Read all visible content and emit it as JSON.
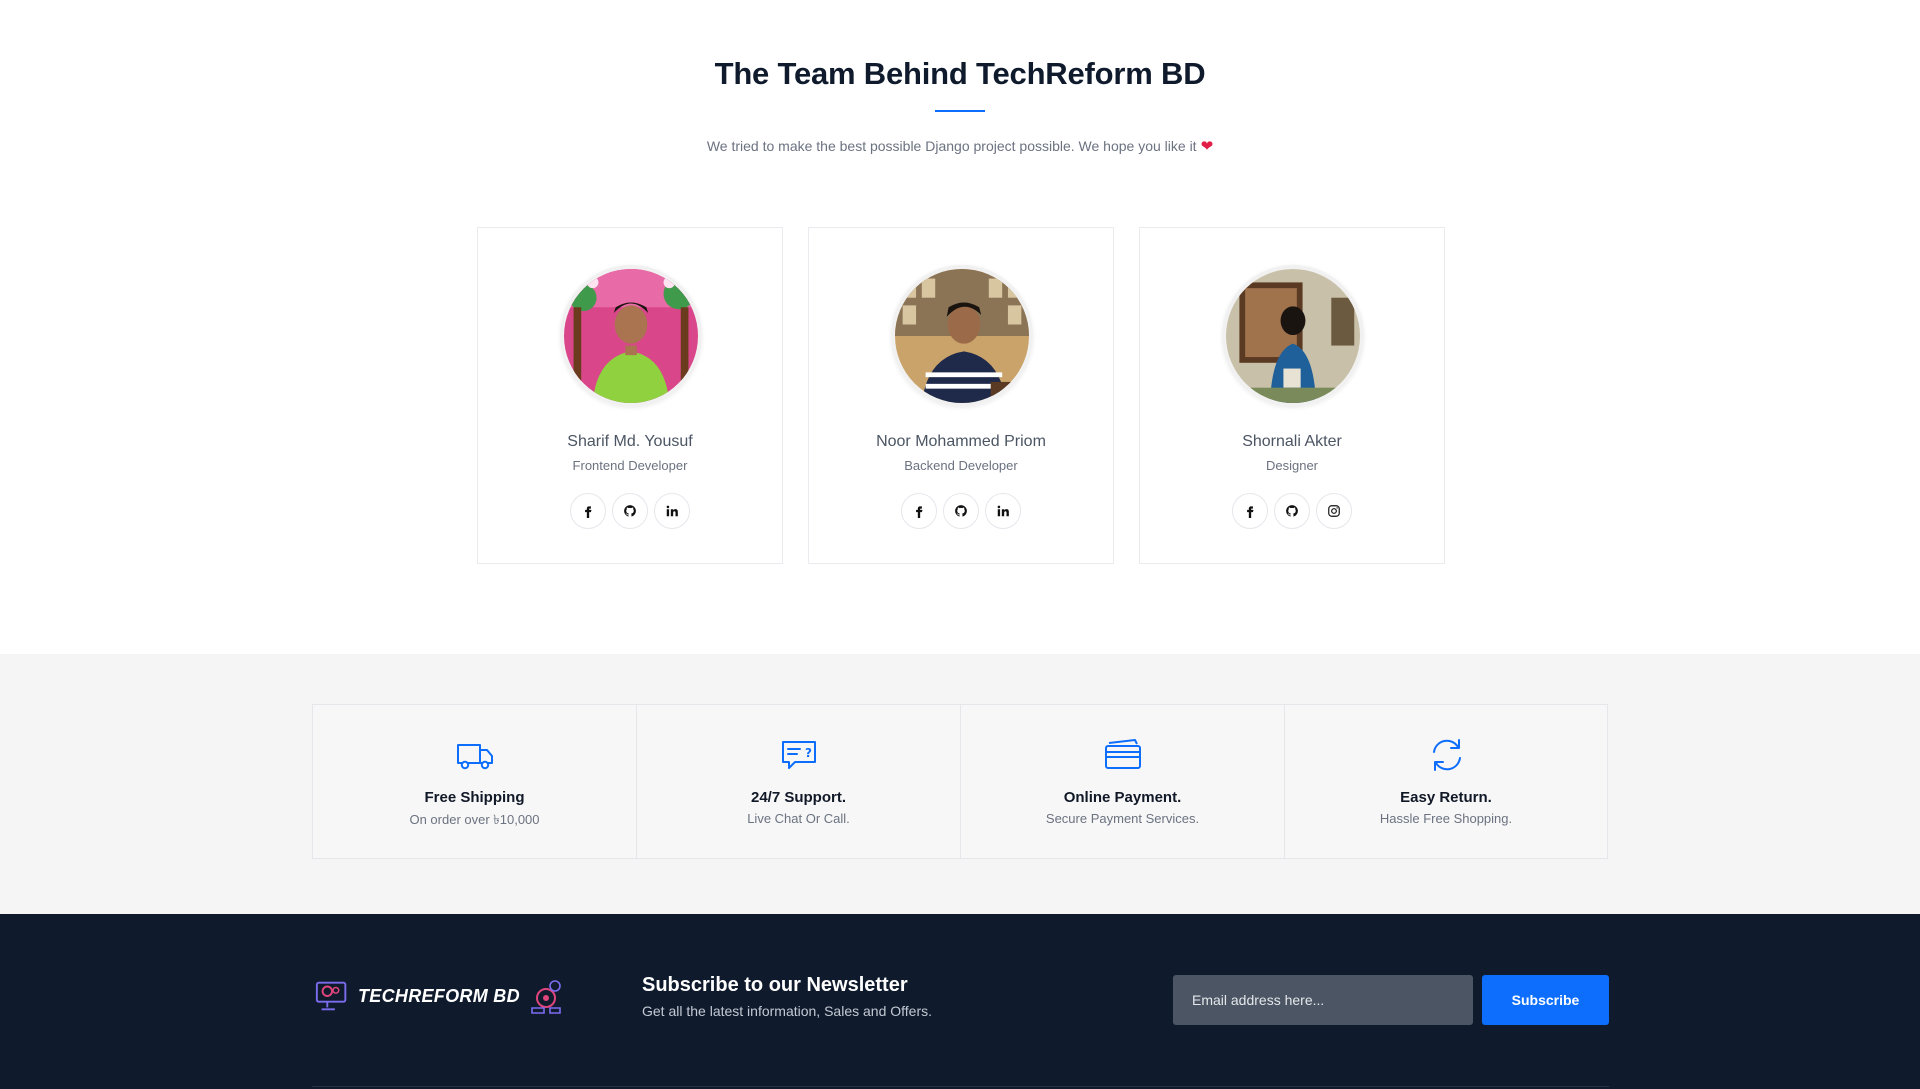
{
  "team": {
    "title": "The Team Behind TechReform BD",
    "subtitle": "We tried to make the best possible Django project possible. We hope you like it",
    "heart_icon": "heart-icon",
    "members": [
      {
        "name": "Sharif Md. Yousuf",
        "role": "Frontend Developer",
        "socials": [
          "facebook-icon",
          "github-icon",
          "linkedin-icon"
        ]
      },
      {
        "name": "Noor Mohammed Priom",
        "role": "Backend Developer",
        "socials": [
          "facebook-icon",
          "github-icon",
          "linkedin-icon"
        ]
      },
      {
        "name": "Shornali Akter",
        "role": "Designer",
        "socials": [
          "facebook-icon",
          "github-icon",
          "instagram-icon"
        ]
      }
    ]
  },
  "features": [
    {
      "icon": "truck-icon",
      "title": "Free Shipping",
      "subtitle": "On order over ৳10,000"
    },
    {
      "icon": "support-ticket-icon",
      "title": "24/7 Support.",
      "subtitle": "Live Chat Or Call."
    },
    {
      "icon": "credit-card-icon",
      "title": "Online Payment.",
      "subtitle": "Secure Payment Services."
    },
    {
      "icon": "refresh-icon",
      "title": "Easy Return.",
      "subtitle": "Hassle Free Shopping."
    }
  ],
  "newsletter": {
    "logo_text": "TECHREFORM BD",
    "title": "Subscribe to our Newsletter",
    "subtitle": "Get all the latest information, Sales and Offers.",
    "email_placeholder": "Email address here...",
    "subscribe_label": "Subscribe"
  },
  "colors": {
    "accent": "#0d6efd",
    "footer_bg": "#0f1b2d",
    "heart": "#e11d48"
  }
}
